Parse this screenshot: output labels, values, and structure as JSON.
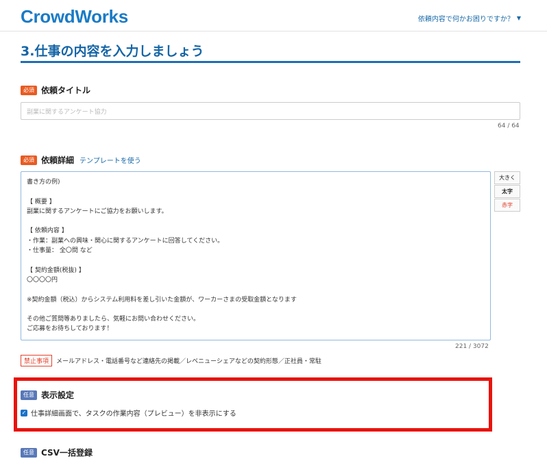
{
  "header": {
    "logo": "CrowdWorks",
    "help_link": "依頼内容で何かお困りですか？"
  },
  "page": {
    "title": "3.仕事の内容を入力しましょう"
  },
  "fields": {
    "title": {
      "badge": "必須",
      "label": "依頼タイトル",
      "value": "副業に関するアンケート協力",
      "count": "64 / 64"
    },
    "detail": {
      "badge": "必須",
      "label": "依頼詳細",
      "template_link": "テンプレートを使う",
      "lines": [
        "書き方の例)",
        "",
        "【 概要 】",
        "副業に関するアンケートにご協力をお願いします。",
        "",
        "【 依頼内容 】",
        "・作業：副業への興味・関心に関するアンケートに回答してください。",
        "・仕事量： 全〇問 など",
        "",
        "【 契約金額(税抜) 】",
        "〇〇〇〇円",
        "",
        "※契約金額（税込）からシステム利用料を差し引いた金額が、ワーカーさまの受取金額となります",
        "",
        "その他ご質問等ありましたら、気軽にお問い合わせください。",
        "ご応募をお待ちしております！"
      ],
      "count": "221 / 3072",
      "tools": {
        "large": "大きく",
        "bold": "太字",
        "red": "赤字"
      }
    },
    "prohibited": {
      "badge": "禁止事項",
      "text": "メールアドレス・電話番号など連絡先の掲載／レベニューシェアなどの契約形態／正社員・常駐"
    },
    "display": {
      "badge": "任意",
      "label": "表示設定",
      "checkbox_label": "仕事詳細画面で、タスクの作業内容（プレビュー）を非表示にする",
      "checked": true
    },
    "csv": {
      "badge": "任意",
      "label": "CSV一括登録"
    }
  }
}
